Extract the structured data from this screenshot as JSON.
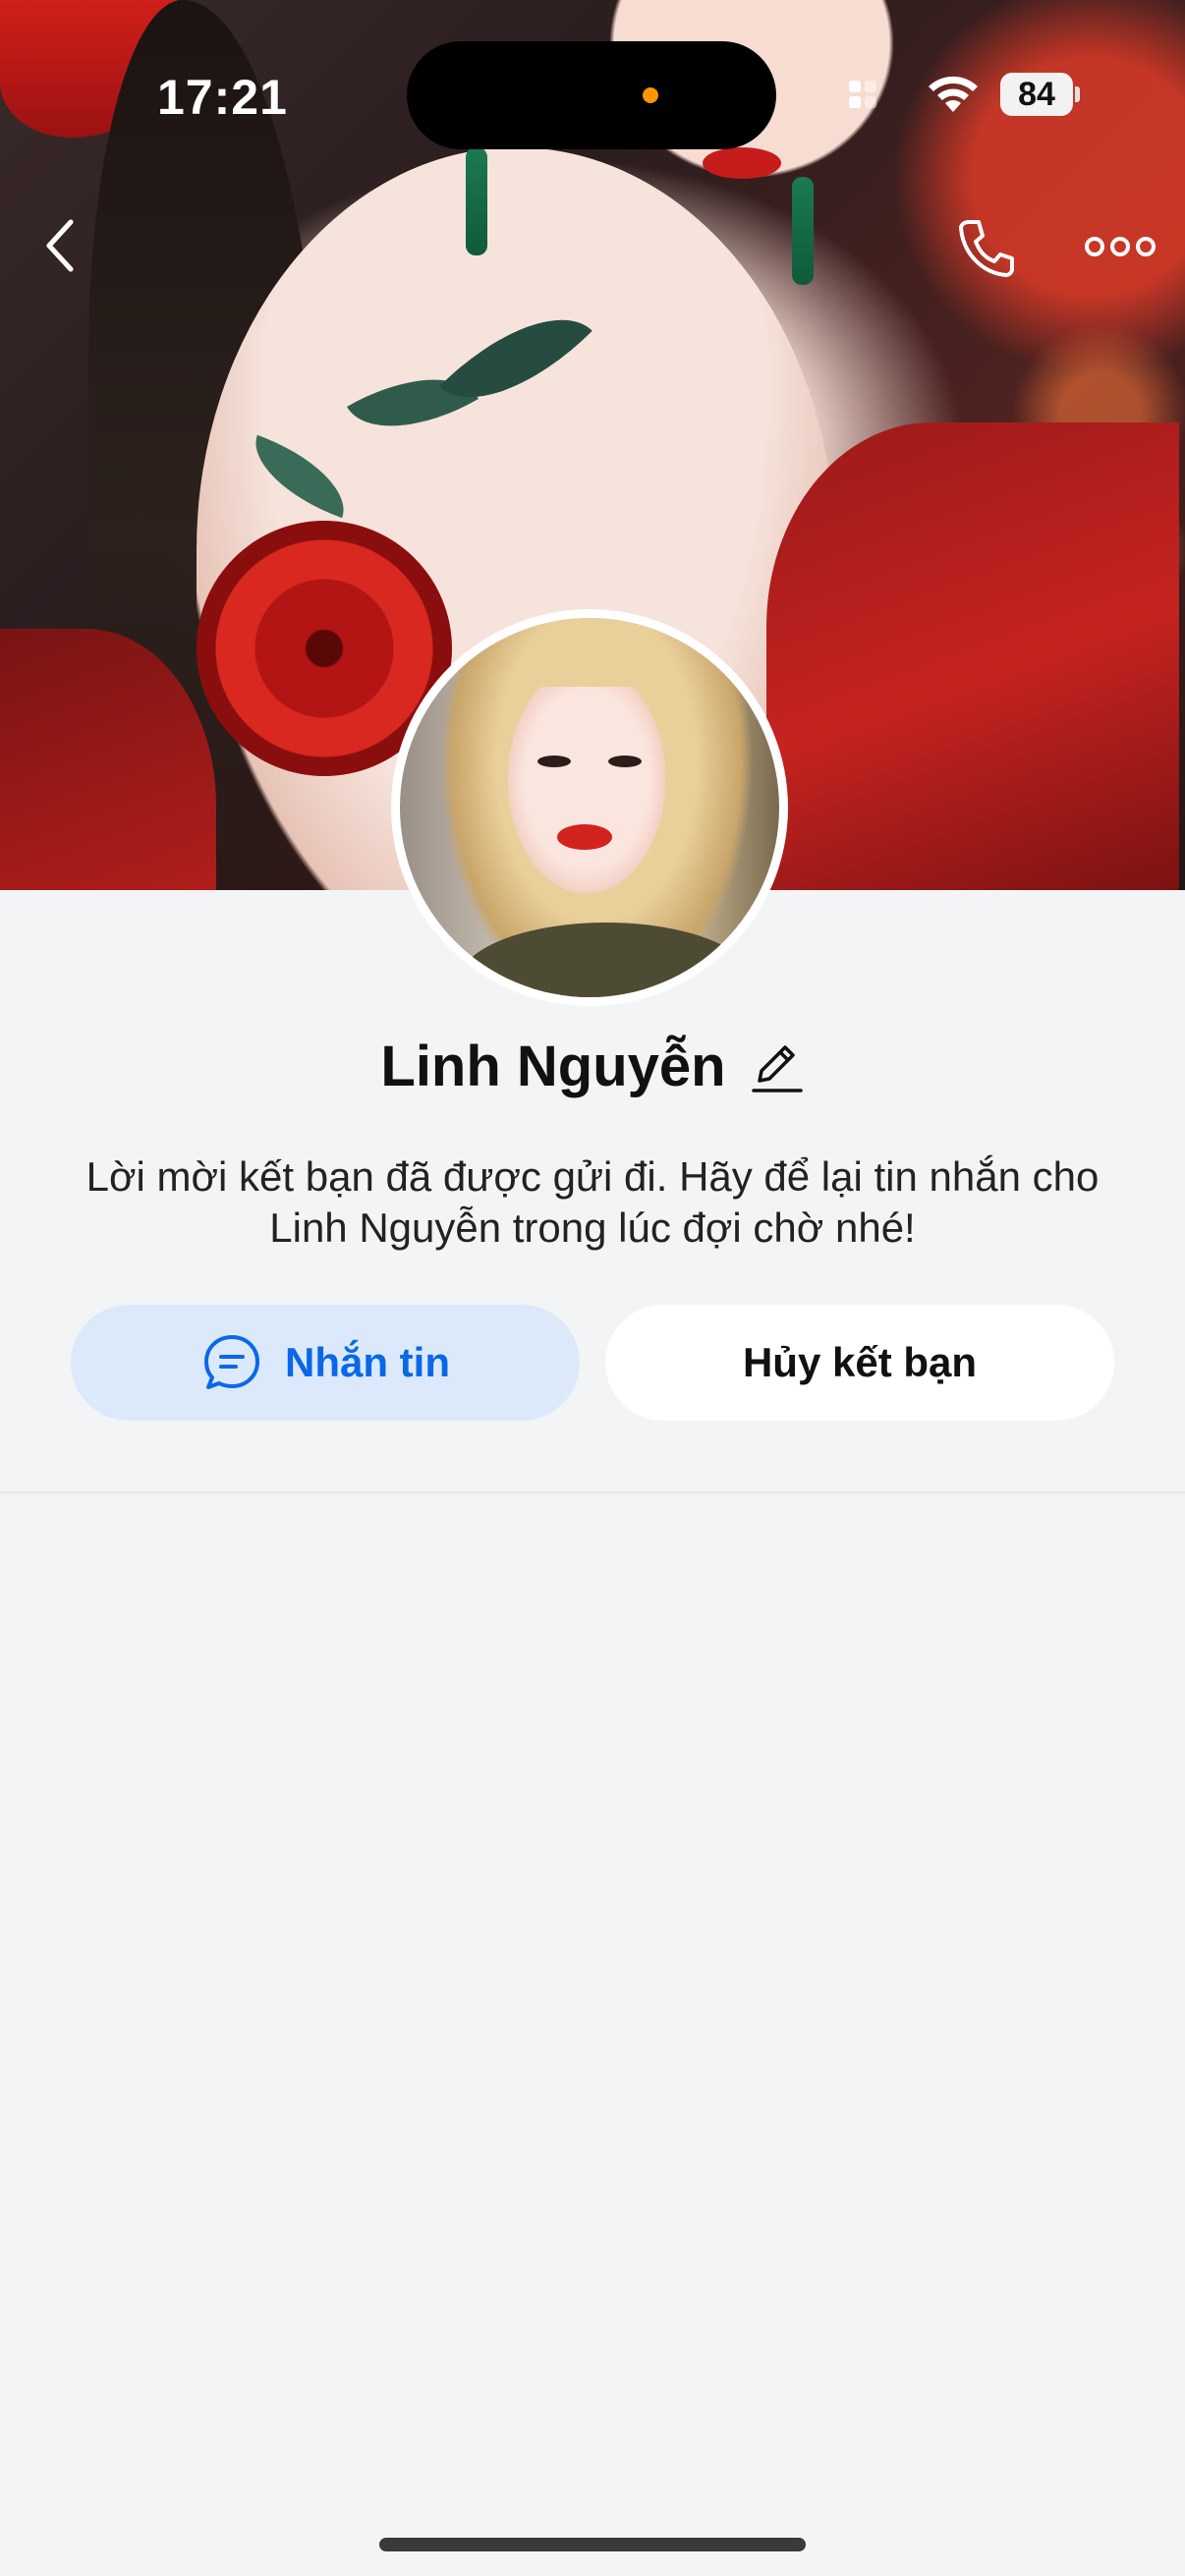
{
  "status_bar": {
    "time": "17:21",
    "battery": "84"
  },
  "profile": {
    "name": "Linh Nguyễn",
    "message": "Lời mời kết bạn đã được gửi đi. Hãy để lại tin nhắn cho Linh Nguyễn trong lúc đợi chờ nhé!"
  },
  "actions": {
    "message_label": "Nhắn tin",
    "unfriend_label": "Hủy kết bạn"
  },
  "icons": {
    "back": "chevron-left-icon",
    "call": "phone-icon",
    "more": "more-horizontal-icon",
    "edit": "pencil-icon",
    "chat": "chat-bubble-icon"
  },
  "colors": {
    "accent": "#0a68e8",
    "accent_bg": "#dce9fb",
    "page_bg": "#f3f4f6"
  }
}
